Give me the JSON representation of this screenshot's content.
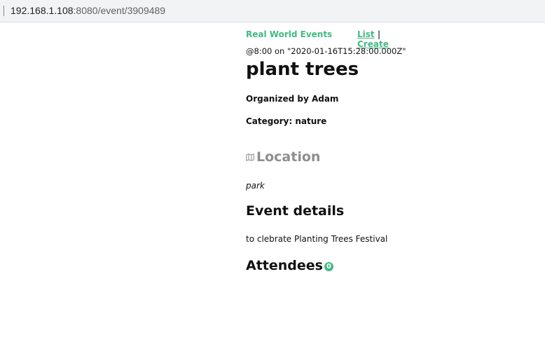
{
  "browser": {
    "url_host": "192.168.1.108",
    "url_rest": ":8080/event/3909489"
  },
  "nav": {
    "brand": "Real World Events",
    "list_label": "List",
    "separator": "|",
    "create_label": "Create"
  },
  "event": {
    "datetime": "@8:00 on \"2020-01-16T15:28:00.000Z\"",
    "title": "plant trees",
    "organizer": "Organized by Adam",
    "category": "Category: nature",
    "location_heading": "Location",
    "location_icon": "map-icon",
    "location": "park",
    "details_heading": "Event details",
    "details": "to clebrate Planting Trees Festival",
    "attendees_heading": "Attendees",
    "attendees_count": "0"
  },
  "colors": {
    "accent": "#42b983",
    "muted_heading": "#8e8e8e"
  }
}
